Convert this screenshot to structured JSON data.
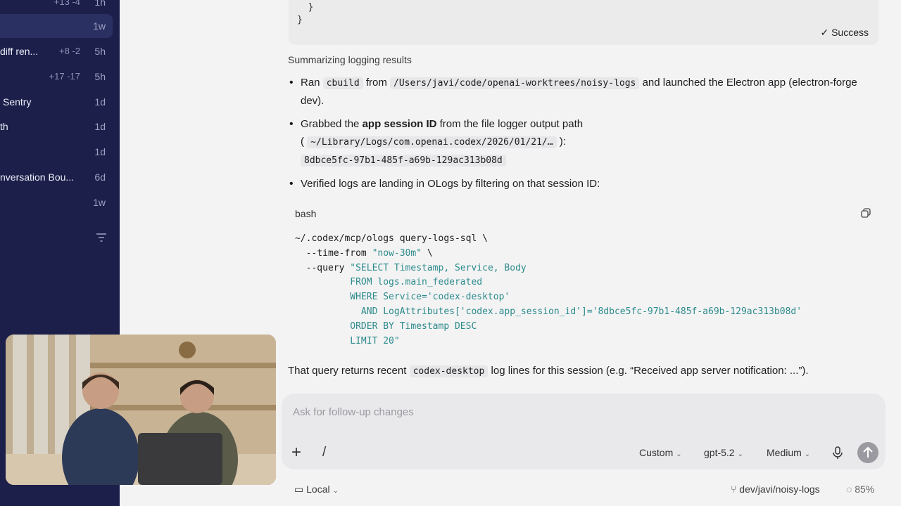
{
  "sidebar": {
    "items": [
      {
        "label": "",
        "diff": "+13 -4",
        "age": "1h"
      },
      {
        "label": "",
        "diff": "",
        "age": "1w",
        "active": true
      },
      {
        "label": "diff ren...",
        "diff": "+8 -2",
        "age": "5h"
      },
      {
        "label": "",
        "diff": "+17 -17",
        "age": "5h"
      },
      {
        "label": "Sentry",
        "diff": "",
        "age": "1d"
      },
      {
        "label": "th",
        "diff": "",
        "age": "1d"
      },
      {
        "label": "",
        "diff": "",
        "age": "1d"
      },
      {
        "label": "nversation Bou...",
        "diff": "",
        "age": "6d"
      },
      {
        "label": "",
        "diff": "",
        "age": "1w"
      }
    ]
  },
  "top_block": {
    "code": "  }\n}",
    "status": "✓ Success"
  },
  "summary": {
    "title": "Summarizing logging results",
    "bullet1": {
      "t1": "Ran",
      "code1": "cbuild",
      "t2": "from",
      "code2": "/Users/javi/code/openai-worktrees/noisy-logs",
      "t3": "and launched the Electron app (electron-forge dev)."
    },
    "bullet2": {
      "t1": "Grabbed the",
      "bold": "app session ID",
      "t2": "from the file logger output path",
      "paren_open": "(",
      "code1": "~/Library/Logs/com.openai.codex/2026/01/21/…",
      "paren_close": "):",
      "code2": "8dbce5fc-97b1-485f-a69b-129ac313b08d"
    },
    "bullet3": "Verified logs are landing in OLogs by filtering on that session ID:"
  },
  "code_card": {
    "lang": "bash",
    "line1": "~/.codex/mcp/ologs query-logs-sql \\",
    "line2_flag": "  --time-from ",
    "line2_str": "\"now-30m\"",
    "line2_tail": " \\",
    "line3_flag": "  --query ",
    "line3_str": "\"SELECT Timestamp, Service, Body",
    "line4": "          FROM logs.main_federated",
    "line5": "          WHERE Service='codex-desktop'",
    "line6": "            AND LogAttributes['codex.app_session_id']='8dbce5fc-97b1-485f-a69b-129ac313b08d'",
    "line7": "          ORDER BY Timestamp DESC",
    "line8": "          LIMIT 20\""
  },
  "final": {
    "t1": "That query returns recent",
    "code": "codex-desktop",
    "t2": "log lines for this session (e.g. “Received app server notification: ...”)."
  },
  "composer": {
    "placeholder": "Ask for follow-up changes",
    "mode": "Custom",
    "model": "gpt-5.2",
    "effort": "Medium"
  },
  "bottom": {
    "env": "Local",
    "branch": "dev/javi/noisy-logs",
    "context": "85%"
  },
  "colors": {
    "sidebar_bg": "#1b1f4a",
    "accent_string": "#2e8b8b"
  }
}
